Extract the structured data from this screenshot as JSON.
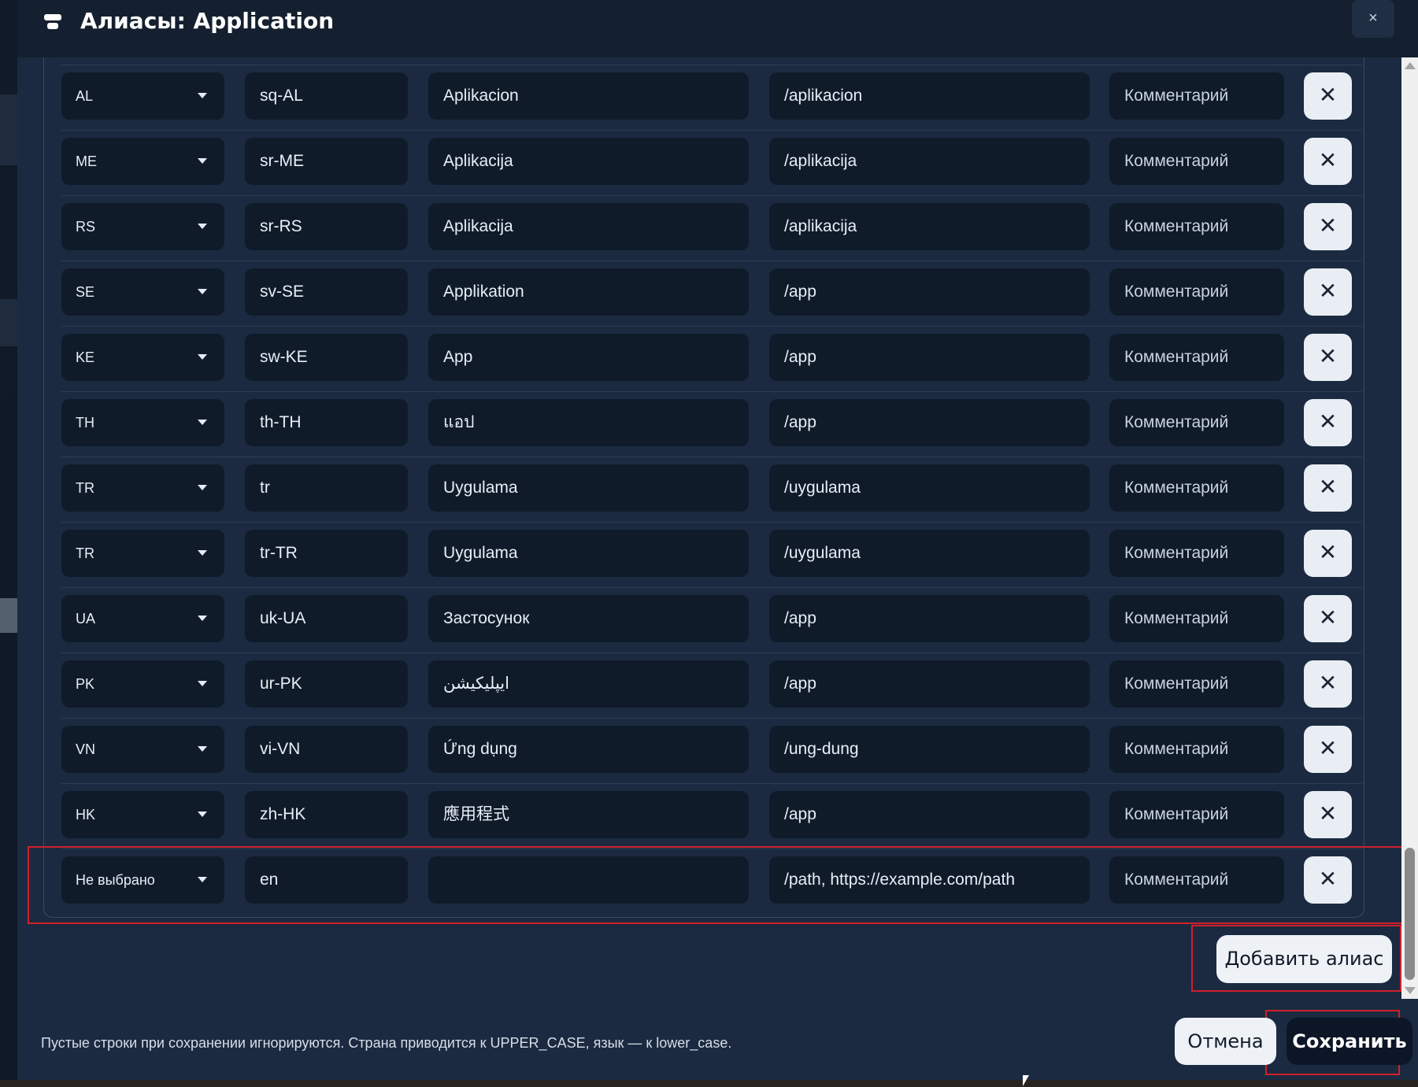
{
  "dialog": {
    "title": "Алиасы: Application",
    "close_symbol": "×"
  },
  "rows": [
    {
      "country": "AL",
      "lang": "sq-AL",
      "name": "Aplikacion",
      "path": "/aplikacion",
      "comment": "Комментарий"
    },
    {
      "country": "ME",
      "lang": "sr-ME",
      "name": "Aplikacija",
      "path": "/aplikacija",
      "comment": "Комментарий"
    },
    {
      "country": "RS",
      "lang": "sr-RS",
      "name": "Aplikacija",
      "path": "/aplikacija",
      "comment": "Комментарий"
    },
    {
      "country": "SE",
      "lang": "sv-SE",
      "name": "Applikation",
      "path": "/app",
      "comment": "Комментарий"
    },
    {
      "country": "KE",
      "lang": "sw-KE",
      "name": "App",
      "path": "/app",
      "comment": "Комментарий"
    },
    {
      "country": "TH",
      "lang": "th-TH",
      "name": "แอป",
      "path": "/app",
      "comment": "Комментарий"
    },
    {
      "country": "TR",
      "lang": "tr",
      "name": "Uygulama",
      "path": "/uygulama",
      "comment": "Комментарий"
    },
    {
      "country": "TR",
      "lang": "tr-TR",
      "name": "Uygulama",
      "path": "/uygulama",
      "comment": "Комментарий"
    },
    {
      "country": "UA",
      "lang": "uk-UA",
      "name": "Застосунок",
      "path": "/app",
      "comment": "Комментарий"
    },
    {
      "country": "PK",
      "lang": "ur-PK",
      "name": "ایپلیکیشن",
      "path": "/app",
      "comment": "Комментарий"
    },
    {
      "country": "VN",
      "lang": "vi-VN",
      "name": "Ứng dụng",
      "path": "/ung-dung",
      "comment": "Комментарий"
    },
    {
      "country": "HK",
      "lang": "zh-HK",
      "name": "應用程式",
      "path": "/app",
      "comment": "Комментарий"
    }
  ],
  "new_row": {
    "country": "Не выбрано",
    "lang": "en",
    "name": "",
    "path": "/path, https://example.com/path",
    "comment": "Комментарий"
  },
  "row_delete_symbol": "✕",
  "buttons": {
    "add_alias": "Добавить алиас",
    "cancel": "Отмена",
    "save": "Сохранить"
  },
  "footer": {
    "note": "Пустые строки при сохранении игнорируются. Страна приводится к UPPER_CASE, язык — к lower_case."
  },
  "colors": {
    "modal_bg": "#1b2a40",
    "header_bg": "#14202f",
    "input_bg": "#101b2a",
    "highlight": "#d0202b",
    "button_light": "#eef2f7",
    "button_dark": "#0c1626"
  }
}
